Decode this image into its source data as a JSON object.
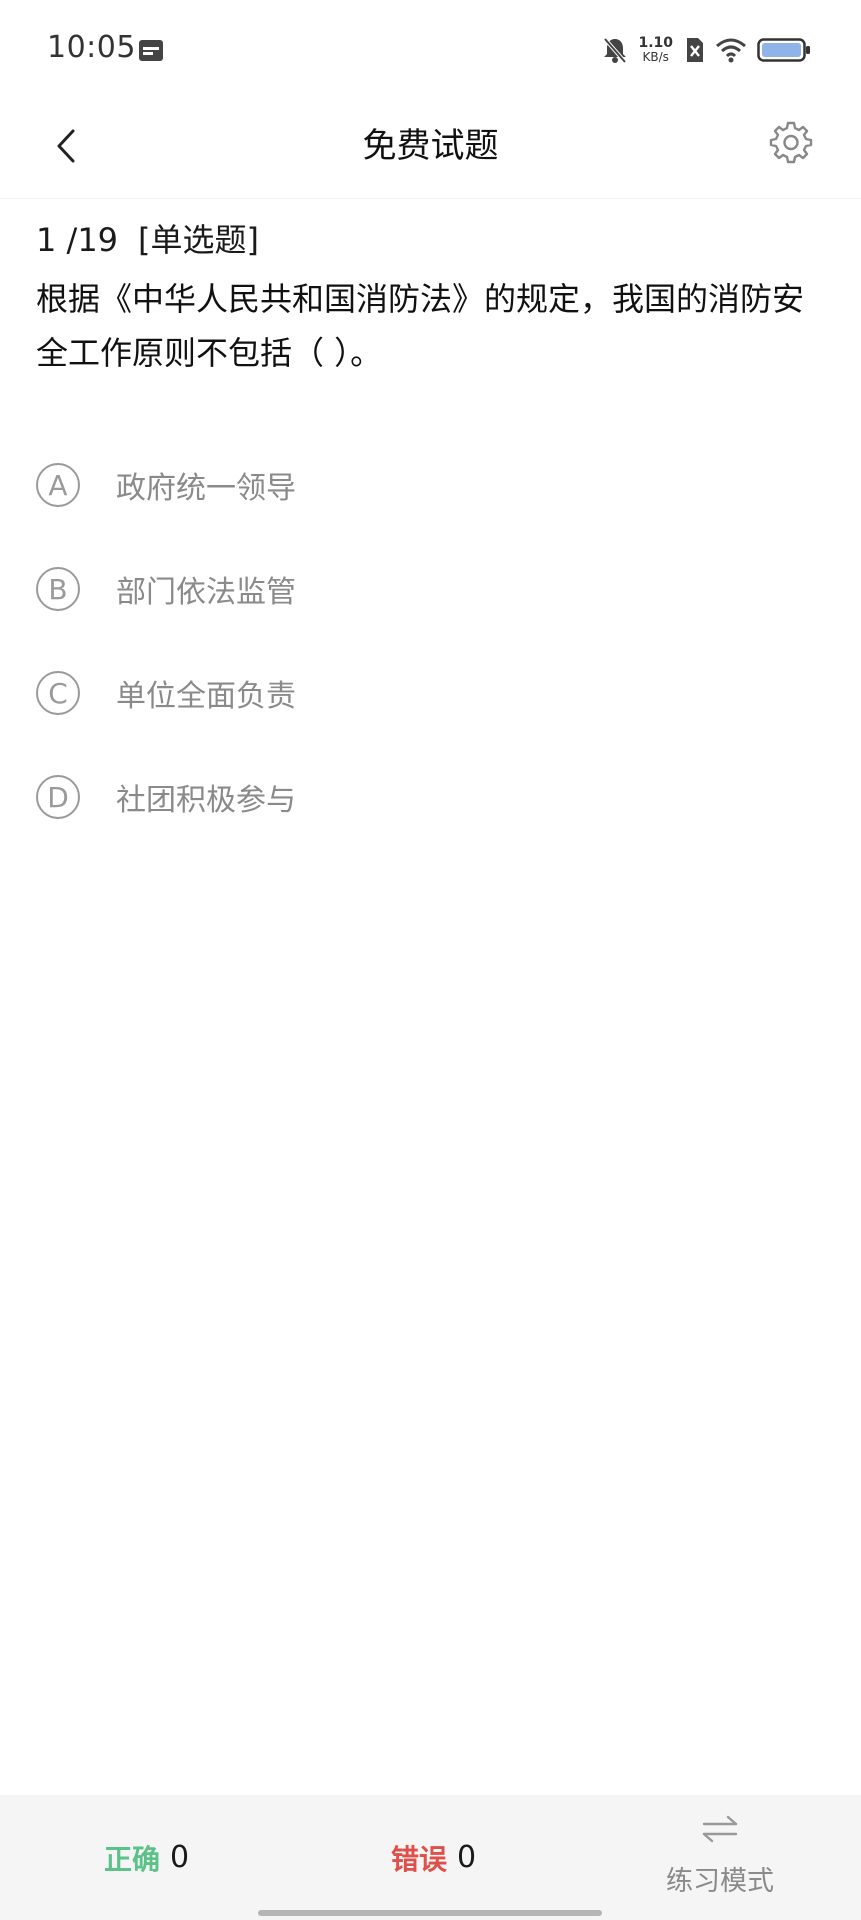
{
  "status_bar": {
    "time": "10:05",
    "speed_value": "1.10",
    "speed_unit": "KB/s",
    "icons": [
      "calendar-icon",
      "bell-muted-icon",
      "sim-disabled-icon",
      "wifi-icon",
      "battery-icon"
    ]
  },
  "header": {
    "title": "免费试题",
    "back_icon": "chevron-left-icon",
    "settings_icon": "gear-icon"
  },
  "question": {
    "number": "1 /19",
    "type": "[单选题]",
    "text": "根据《中华人民共和国消防法》的规定，我国的消防安全工作原则不包括（ ）。"
  },
  "options": [
    {
      "letter": "A",
      "text": "政府统一领导"
    },
    {
      "letter": "B",
      "text": "部门依法监管"
    },
    {
      "letter": "C",
      "text": "单位全面负责"
    },
    {
      "letter": "D",
      "text": "社团积极参与"
    }
  ],
  "bottom_bar": {
    "correct_label": "正确",
    "correct_count": "0",
    "wrong_label": "错误",
    "wrong_count": "0",
    "mode_label": "练习模式",
    "mode_icon": "swap-arrows-icon"
  },
  "colors": {
    "correct": "#5cc28a",
    "wrong": "#e0504a",
    "option_gray": "#9a9a9a",
    "bottom_bar_bg": "#f5f5f5"
  }
}
